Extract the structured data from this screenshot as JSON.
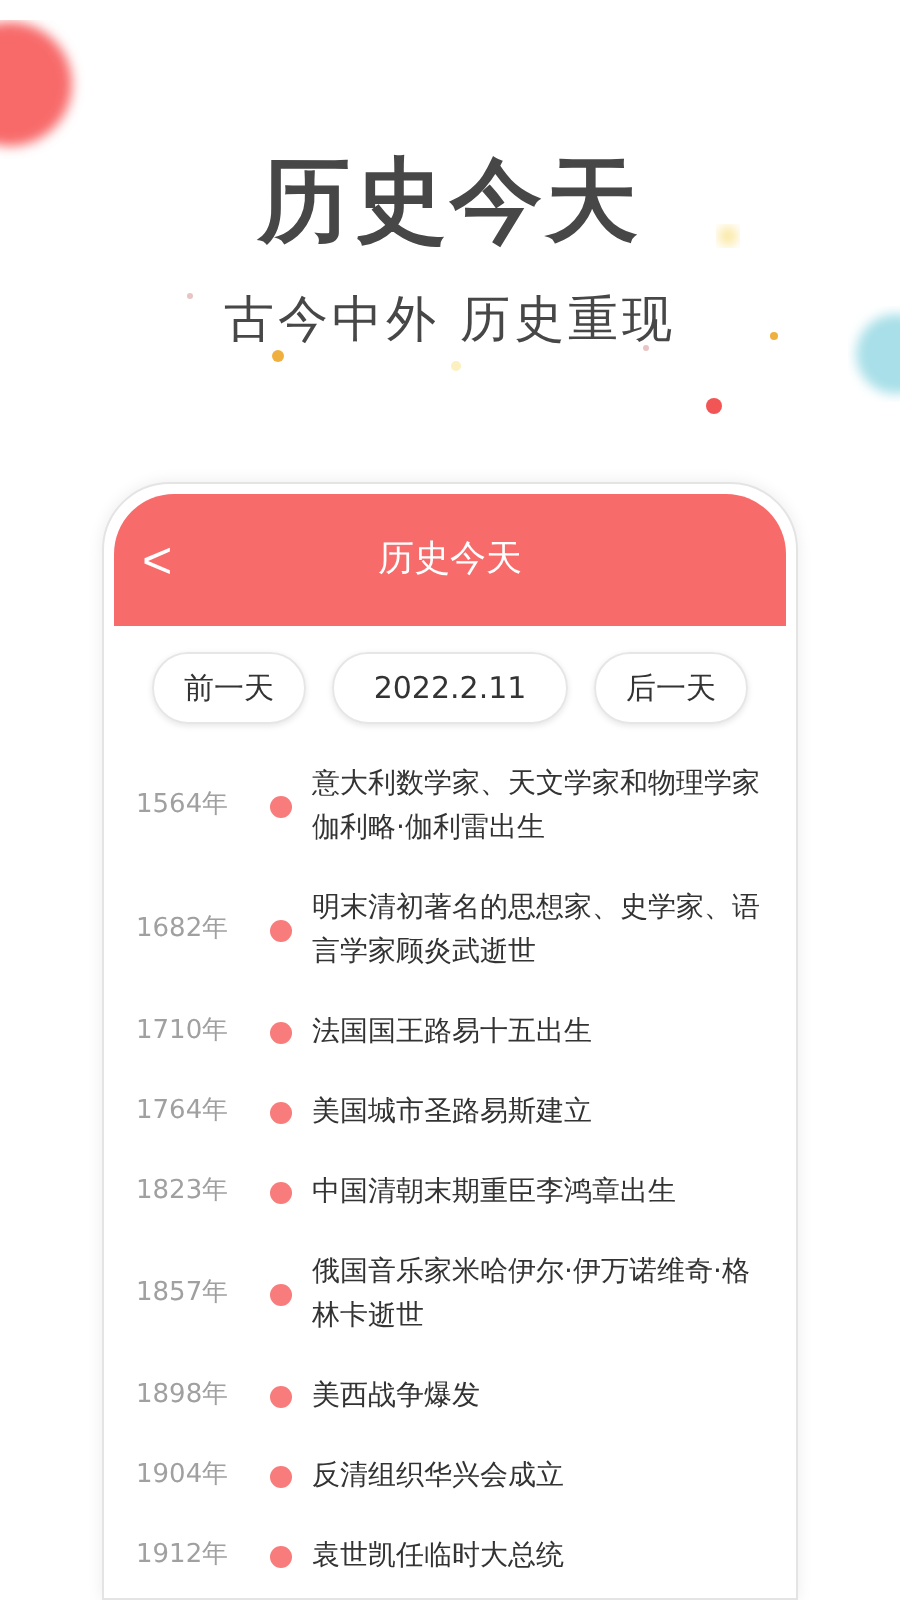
{
  "headline": "历史今天",
  "tagline": "古今中外 历史重现",
  "app": {
    "title": "历史今天",
    "back": "<"
  },
  "date_nav": {
    "previous": "前一天",
    "date": "2022.2.11",
    "next": "后一天"
  },
  "events": [
    {
      "year": "1564年",
      "text": "意大利数学家、天文学家和物理学家伽利略·伽利雷出生"
    },
    {
      "year": "1682年",
      "text": "明末清初著名的思想家、史学家、语言学家顾炎武逝世"
    },
    {
      "year": "1710年",
      "text": "法国国王路易十五出生"
    },
    {
      "year": "1764年",
      "text": "美国城市圣路易斯建立"
    },
    {
      "year": "1823年",
      "text": "中国清朝末期重臣李鸿章出生"
    },
    {
      "year": "1857年",
      "text": "俄国音乐家米哈伊尔·伊万诺维奇·格林卡逝世"
    },
    {
      "year": "1898年",
      "text": "美西战争爆发"
    },
    {
      "year": "1904年",
      "text": "反清组织华兴会成立"
    },
    {
      "year": "1912年",
      "text": "袁世凯任临时大总统"
    }
  ]
}
